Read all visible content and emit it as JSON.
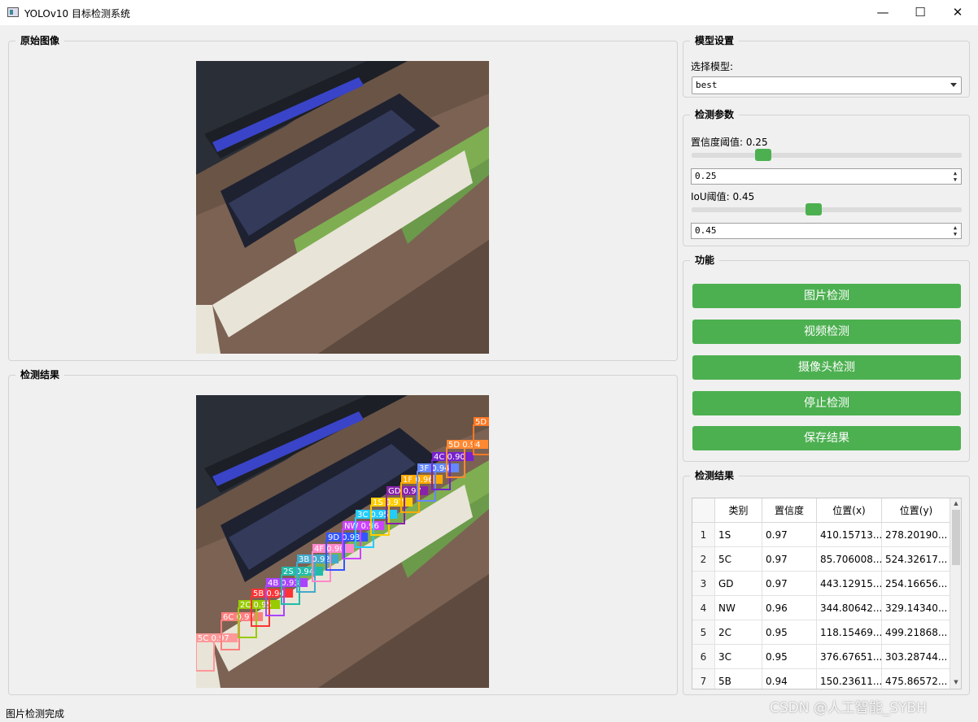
{
  "window": {
    "title": "YOLOv10 目标检测系统",
    "min_glyph": "—",
    "max_glyph": "☐",
    "close_glyph": "✕"
  },
  "original_group": {
    "title": "原始图像"
  },
  "result_group": {
    "title": "检测结果"
  },
  "model_group": {
    "title": "模型设置",
    "select_label": "选择模型:",
    "selected": "best"
  },
  "param_group": {
    "title": "检测参数",
    "conf_label": "置信度阈值: 0.25",
    "conf_value": "0.25",
    "conf_level": 0.25,
    "iou_label": "IoU阈值: 0.45",
    "iou_value": "0.45",
    "iou_level": 0.45
  },
  "func_group": {
    "title": "功能",
    "buttons": [
      "图片检测",
      "视频检测",
      "摄像头检测",
      "停止检测",
      "保存结果"
    ]
  },
  "table_group": {
    "title": "检测结果",
    "headers": [
      "类别",
      "置信度",
      "位置(x)",
      "位置(y)"
    ],
    "rows": [
      {
        "n": "1",
        "cls": "1S",
        "conf": "0.97",
        "x": "410.15713...",
        "y": "278.20190..."
      },
      {
        "n": "2",
        "cls": "5C",
        "conf": "0.97",
        "x": "85.706008...",
        "y": "524.32617..."
      },
      {
        "n": "3",
        "cls": "GD",
        "conf": "0.97",
        "x": "443.12915...",
        "y": "254.16656..."
      },
      {
        "n": "4",
        "cls": "NW",
        "conf": "0.96",
        "x": "344.80642...",
        "y": "329.14340..."
      },
      {
        "n": "5",
        "cls": "2C",
        "conf": "0.95",
        "x": "118.15469...",
        "y": "499.21868..."
      },
      {
        "n": "6",
        "cls": "3C",
        "conf": "0.95",
        "x": "376.67651...",
        "y": "303.28744..."
      },
      {
        "n": "7",
        "cls": "5B",
        "conf": "0.94",
        "x": "150.23611...",
        "y": "475.86572..."
      }
    ]
  },
  "detections": [
    {
      "label": "5C 0.97",
      "color": "#ff9999"
    },
    {
      "label": "6C 0.97",
      "color": "#ff7f7f"
    },
    {
      "label": "2C 0.95",
      "color": "#99cc00"
    },
    {
      "label": "5B 0.94",
      "color": "#ff3333"
    },
    {
      "label": "4B 0.93",
      "color": "#aa44ff"
    },
    {
      "label": "2S 0.94",
      "color": "#22bbaa"
    },
    {
      "label": "3B 0.92",
      "color": "#44aacc"
    },
    {
      "label": "4F 0.90",
      "color": "#ff88cc"
    },
    {
      "label": "9D 0.93",
      "color": "#3355ff"
    },
    {
      "label": "NW 0.96",
      "color": "#cc44ff"
    },
    {
      "label": "3C 0.95",
      "color": "#22ccff"
    },
    {
      "label": "1S 0.97",
      "color": "#ffcc00"
    },
    {
      "label": "GD 0.97",
      "color": "#8822aa"
    },
    {
      "label": "1F 0.96",
      "color": "#ffaa00"
    },
    {
      "label": "3F 0.94",
      "color": "#6688ff"
    },
    {
      "label": "4C 0.90",
      "color": "#7722cc"
    },
    {
      "label": "5D 0.94",
      "color": "#ff8833"
    },
    {
      "label": "5D",
      "color": "#ff7722"
    }
  ],
  "status": "图片检测完成",
  "watermark": "CSDN @人工智能_SYBH"
}
